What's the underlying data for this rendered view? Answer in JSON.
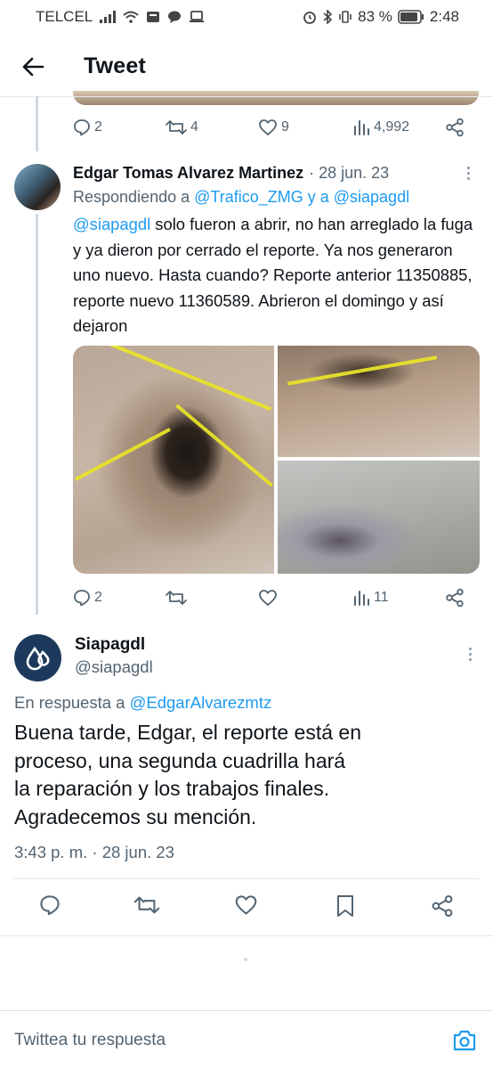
{
  "status_bar": {
    "carrier": "TELCEL",
    "battery": "83 %",
    "time": "2:48"
  },
  "header": {
    "title": "Tweet"
  },
  "prev_tweet_actions": {
    "replies": "2",
    "retweets": "4",
    "likes": "9",
    "views": "4,992"
  },
  "reply_tweet": {
    "name": "Edgar Tomas Alvarez Martinez",
    "date": "· 28 jun. 23",
    "replying_prefix": "Respondiendo a ",
    "replying_to_1": "@Trafico_ZMG",
    "replying_joiner": " y a ",
    "replying_to_2": "@siapagdl",
    "mention": "@siapagdl",
    "text": " solo fueron a abrir, no han arreglado la fuga y ya dieron por cerrado el reporte. Ya nos generaron uno nuevo. Hasta cuando?  Reporte anterior 11350885, reporte nuevo 11360589. Abrieron el domingo y así dejaron",
    "actions": {
      "replies": "2",
      "retweets": "",
      "likes": "",
      "views": "11"
    }
  },
  "main_tweet": {
    "name": "Siapagdl",
    "handle": "@siapagdl",
    "in_reply_prefix": "En respuesta a ",
    "in_reply_to": "@EdgarAlvarezmtz",
    "text_lines": [
      "Buena tarde, Edgar, el reporte está en",
      "proceso, una segunda cuadrilla hará",
      "la reparación y los trabajos finales.",
      "Agradecemos su mención."
    ],
    "timestamp": "3:43 p. m. · 28 jun. 23"
  },
  "compose": {
    "placeholder": "Twittea tu respuesta"
  },
  "colors": {
    "link": "#1d9bf0",
    "muted": "#536471",
    "text": "#0f1419",
    "brand_avatar": "#1d3a5c"
  }
}
